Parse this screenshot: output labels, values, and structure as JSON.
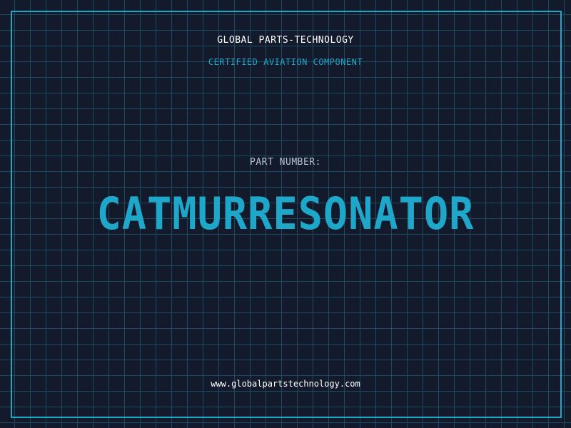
{
  "header": {
    "company": "GLOBAL PARTS-TECHNOLOGY",
    "subtitle": "CERTIFIED AVIATION COMPONENT"
  },
  "main": {
    "label": "PART NUMBER:",
    "part_number": "CATMURRESONATOR"
  },
  "footer": {
    "url": "www.globalpartstechnology.com"
  },
  "colors": {
    "background": "#121a2b",
    "grid": "#1d4a5e",
    "accent": "#1ea7c9",
    "label": "#b7c3cf",
    "text": "#ffffff"
  }
}
